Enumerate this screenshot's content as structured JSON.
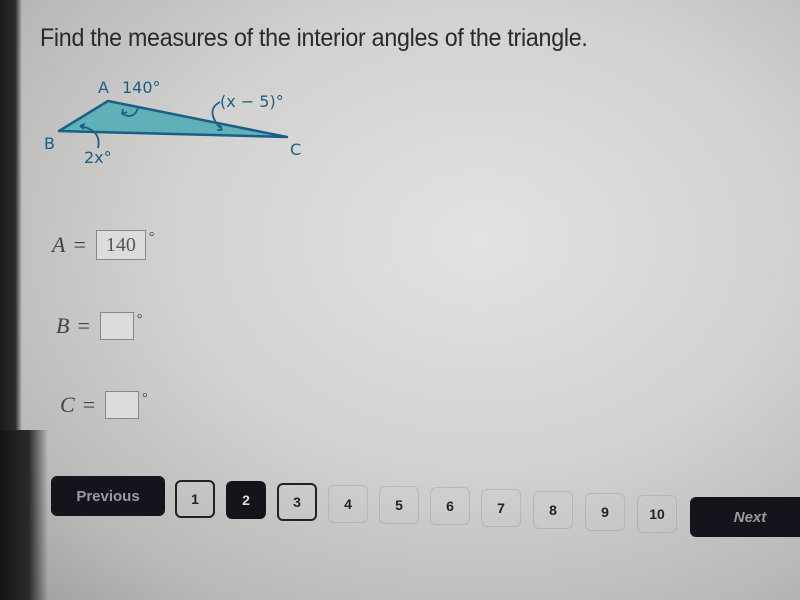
{
  "question": "Find the measures of the interior angles of the triangle.",
  "figure": {
    "vertices": [
      "A",
      "B",
      "C"
    ],
    "angle_labels": {
      "A": "140°",
      "B": "2x°",
      "C": "(x − 5)°"
    },
    "fill_color": "#5fb0b7",
    "stroke_color": "#1c5f86"
  },
  "answers": [
    {
      "var": "A",
      "eq": "=",
      "value": "140",
      "unit": "°"
    },
    {
      "var": "B",
      "eq": "=",
      "value": "",
      "unit": "°"
    },
    {
      "var": "C",
      "eq": "=",
      "value": "",
      "unit": "°"
    }
  ],
  "nav": {
    "previous_label": "Previous",
    "next_label": "Next",
    "pages": [
      "1",
      "2",
      "3",
      "4",
      "5",
      "6",
      "7",
      "8",
      "9",
      "10"
    ],
    "current_page": "2"
  }
}
